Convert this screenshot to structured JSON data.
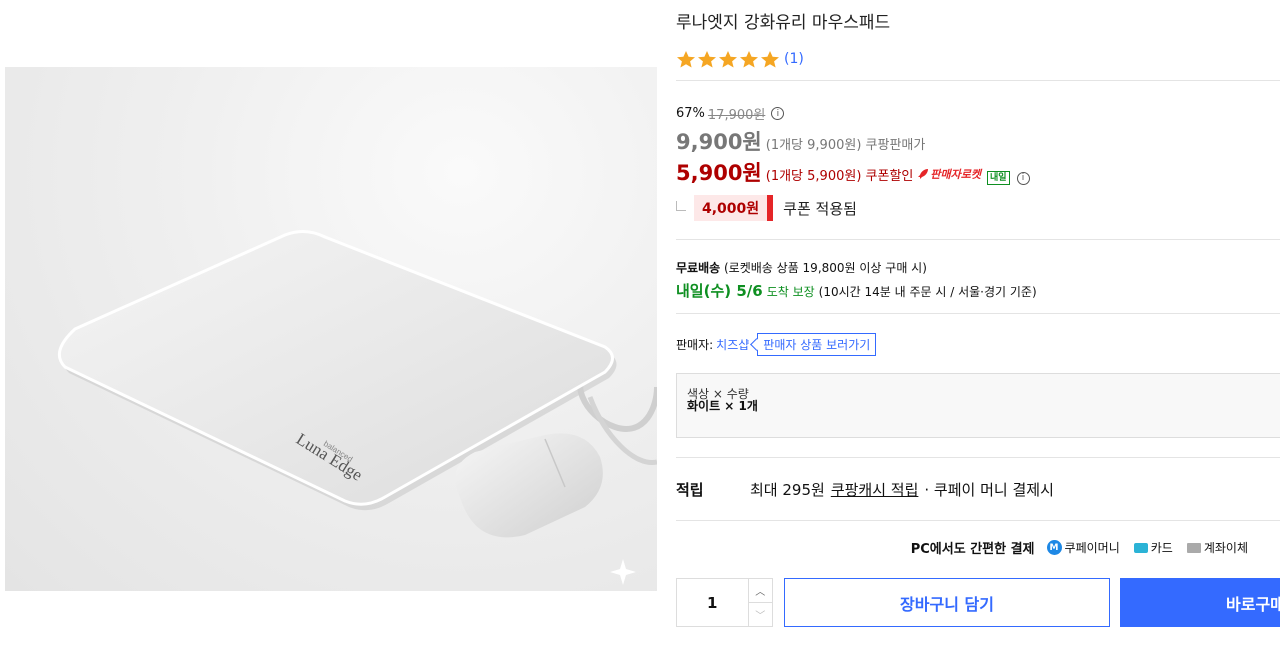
{
  "product": {
    "title": "루나엣지 강화유리 마우스패드",
    "rating_stars": 5,
    "review_count": "(1)",
    "image_brand_text": "Luna Edge",
    "image_brand_sub": "balanced"
  },
  "pricing": {
    "discount_rate": "67%",
    "original_price": "17,900원",
    "sale_price": "9,900원",
    "sale_unit": "(1개당 9,900원) 쿠팡판매가",
    "coupon_price": "5,900원",
    "coupon_unit": "(1개당 5,900원) 쿠폰할인",
    "seller_rocket": "판매자로켓",
    "tomorrow_badge": "내일",
    "coupon_amount": "4,000원",
    "coupon_applied_text": "쿠폰 적용됨"
  },
  "shipping": {
    "free_label": "무료배송",
    "free_condition": "(로켓배송 상품 19,800원 이상 구매 시)",
    "arrival_date": "내일(수) 5/6",
    "arrival_label": "도착 보장",
    "arrival_condition": "(10시간 14분 내 주문 시 / 서울·경기 기준)"
  },
  "seller": {
    "label": "판매자:",
    "name": "치즈샵",
    "link_label": "판매자 상품 보러가기"
  },
  "option": {
    "label": "색상 × 수량",
    "value": "화이트 × 1개"
  },
  "cashback": {
    "title": "적립",
    "prefix": "최대 295원",
    "link": "쿠팡캐시 적립",
    "suffix": "· 쿠페이 머니 결제시"
  },
  "payment": {
    "title": "PC에서도 간편한 결제",
    "money_icon_letter": "M",
    "money": "쿠페이머니",
    "card": "카드",
    "bank": "계좌이체"
  },
  "actions": {
    "quantity": "1",
    "cart_label": "장바구니 담기",
    "buy_label": "바로구매"
  },
  "colors": {
    "accent": "#346aff",
    "coupon_red": "#ae0000",
    "green": "#0e8f21",
    "star": "#f5a623"
  }
}
